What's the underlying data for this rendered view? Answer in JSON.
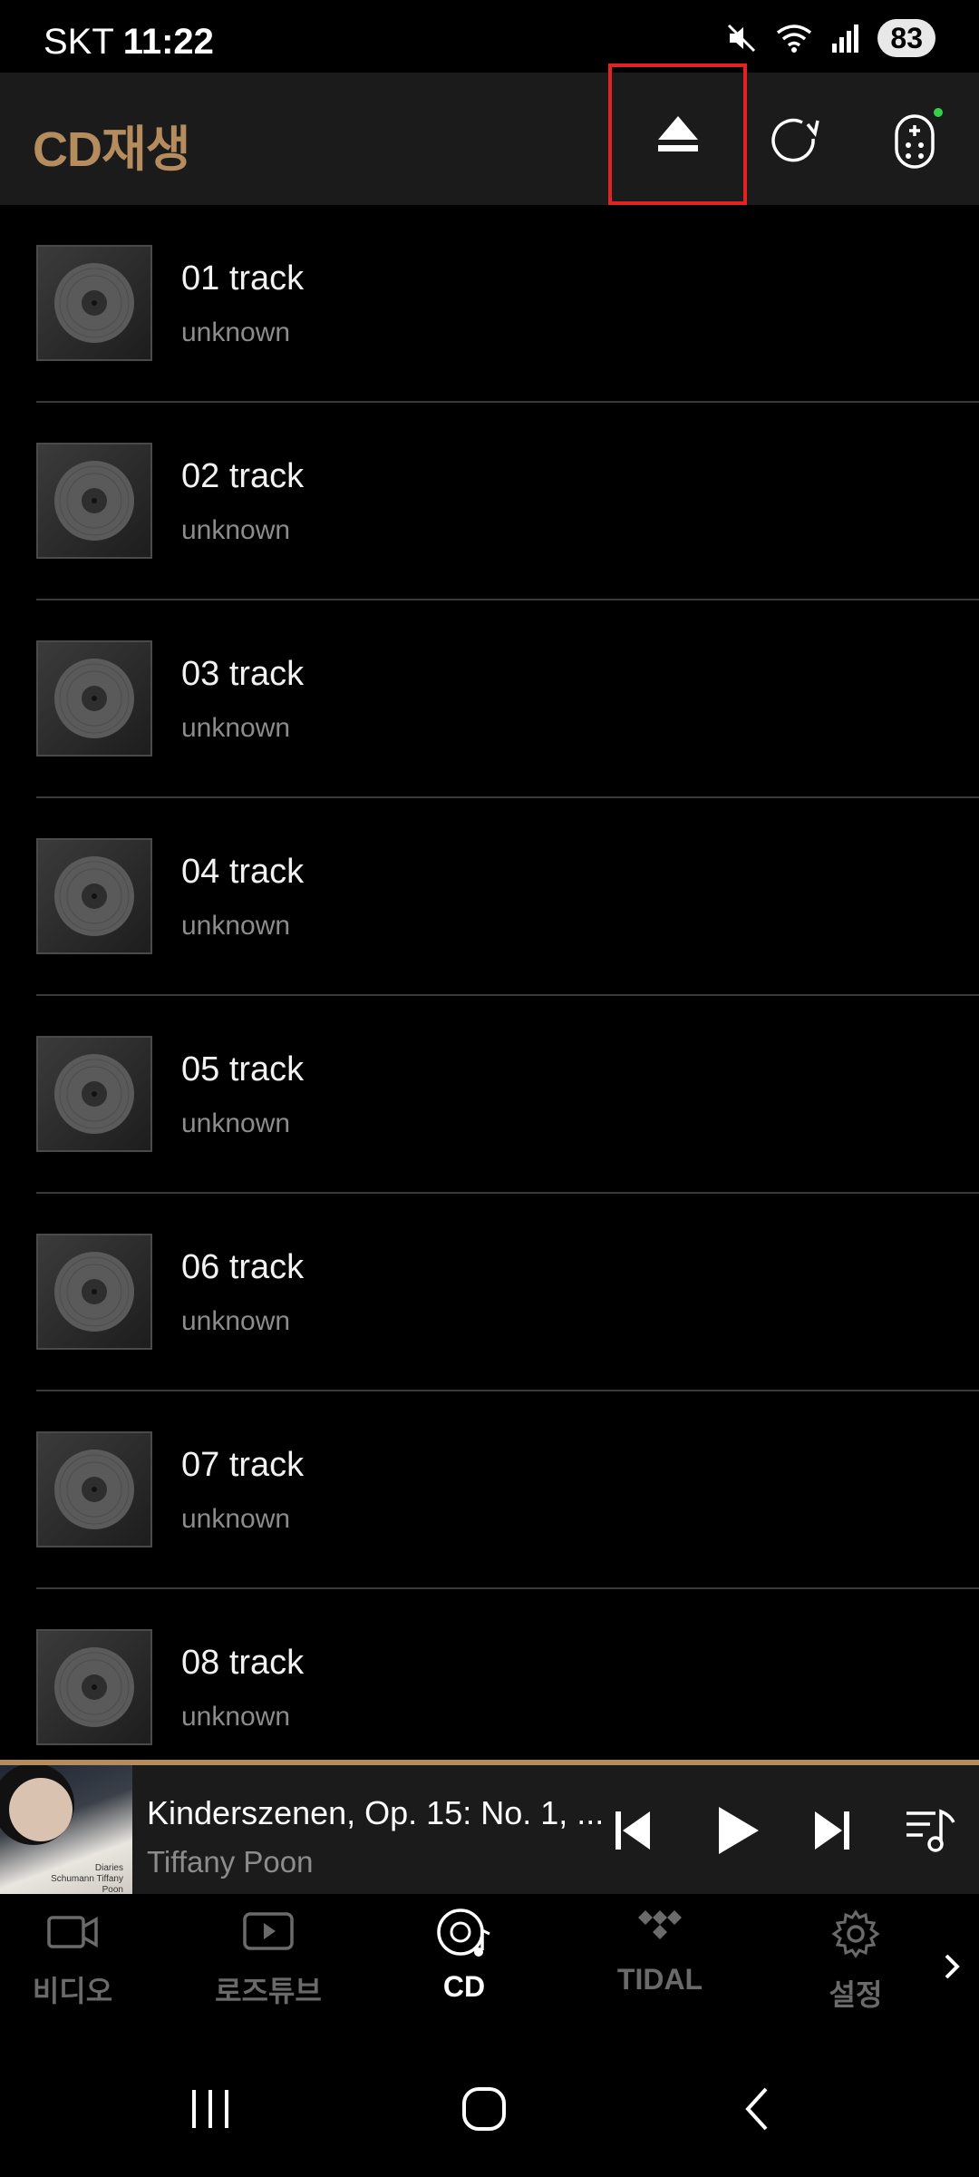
{
  "status": {
    "carrier": "SKT",
    "time": "11:22",
    "battery": "83"
  },
  "header": {
    "title": "CD재생"
  },
  "tracks": [
    {
      "title": "01 track",
      "artist": "unknown"
    },
    {
      "title": "02 track",
      "artist": "unknown"
    },
    {
      "title": "03 track",
      "artist": "unknown"
    },
    {
      "title": "04 track",
      "artist": "unknown"
    },
    {
      "title": "05 track",
      "artist": "unknown"
    },
    {
      "title": "06 track",
      "artist": "unknown"
    },
    {
      "title": "07 track",
      "artist": "unknown"
    },
    {
      "title": "08 track",
      "artist": "unknown"
    }
  ],
  "player": {
    "title": "Kinderszenen, Op. 15: No. 1, ...",
    "artist": "Tiffany Poon",
    "album_caption": "Diaries Schumann Tiffany Poon"
  },
  "nav": {
    "items": [
      {
        "label": "비디오",
        "icon": "video-icon"
      },
      {
        "label": "로즈튜브",
        "icon": "play-box-icon"
      },
      {
        "label": "CD",
        "icon": "cd-icon"
      },
      {
        "label": "TIDAL",
        "icon": "tidal-icon"
      },
      {
        "label": "설정",
        "icon": "gear-icon"
      }
    ],
    "active": "CD"
  },
  "colors": {
    "accent": "#b58c5d",
    "highlight_box": "#e32222",
    "header_bg": "#1b1b1b",
    "remote_dot": "#35d04a"
  }
}
